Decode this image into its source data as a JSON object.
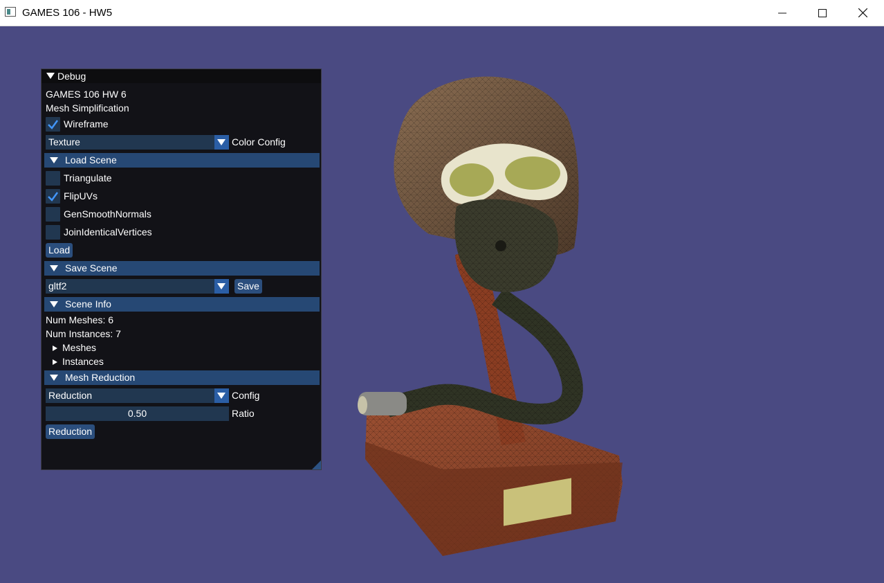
{
  "window": {
    "title": "GAMES 106 - HW5"
  },
  "panel": {
    "title": "Debug",
    "info_line1": "GAMES 106 HW 6",
    "info_line2": "Mesh Simplification",
    "wireframe": {
      "label": "Wireframe",
      "checked": true
    },
    "color_config": {
      "value": "Texture",
      "label": "Color Config"
    },
    "load_scene": {
      "header": "Load Scene",
      "options": [
        {
          "label": "Triangulate",
          "checked": false
        },
        {
          "label": "FlipUVs",
          "checked": true
        },
        {
          "label": "GenSmoothNormals",
          "checked": false
        },
        {
          "label": "JoinIdenticalVertices",
          "checked": false
        }
      ],
      "button": "Load"
    },
    "save_scene": {
      "header": "Save Scene",
      "format": "gltf2",
      "button": "Save"
    },
    "scene_info": {
      "header": "Scene Info",
      "num_meshes": "Num Meshes: 6",
      "num_instances": "Num Instances: 7",
      "meshes_node": "Meshes",
      "instances_node": "Instances"
    },
    "mesh_reduction": {
      "header": "Mesh Reduction",
      "config_value": "Reduction",
      "config_label": "Config",
      "ratio_value": "0.50",
      "ratio_label": "Ratio",
      "button": "Reduction"
    }
  },
  "colors": {
    "viewport_bg": "#4a4a82",
    "panel_bg": "#111114",
    "header_bg": "#264874",
    "frame_bg": "#213750",
    "accent": "#4296fa"
  }
}
